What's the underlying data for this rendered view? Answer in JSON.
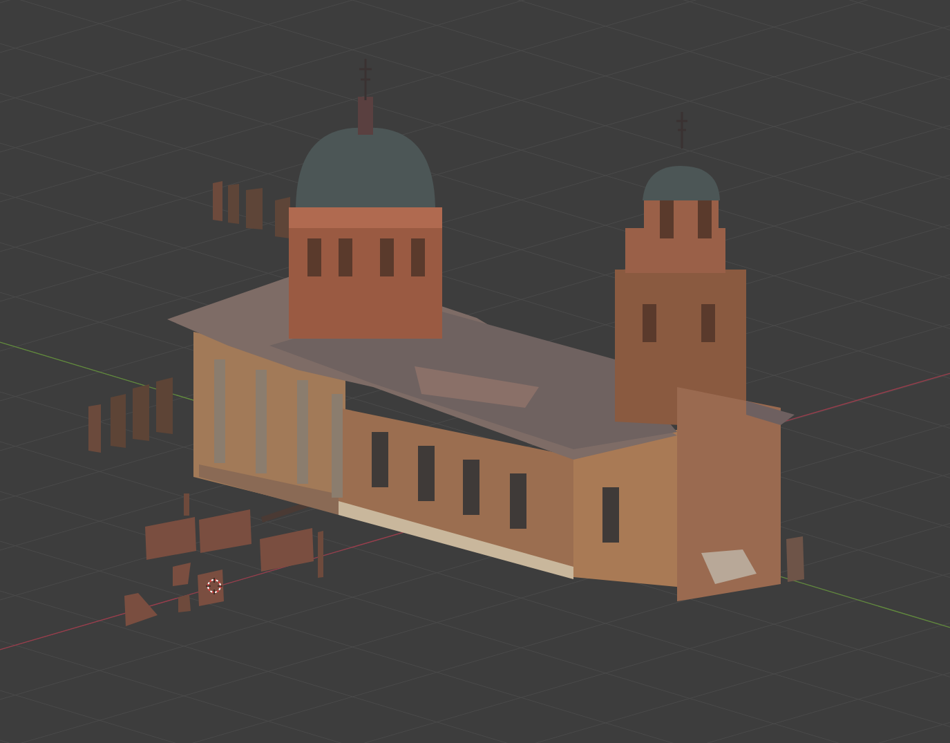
{
  "viewport": {
    "axis_lines": [
      {
        "kind": "x",
        "color": "#9c3d4c"
      },
      {
        "kind": "y",
        "color": "#628c3c"
      }
    ],
    "cursor_3d": true
  }
}
